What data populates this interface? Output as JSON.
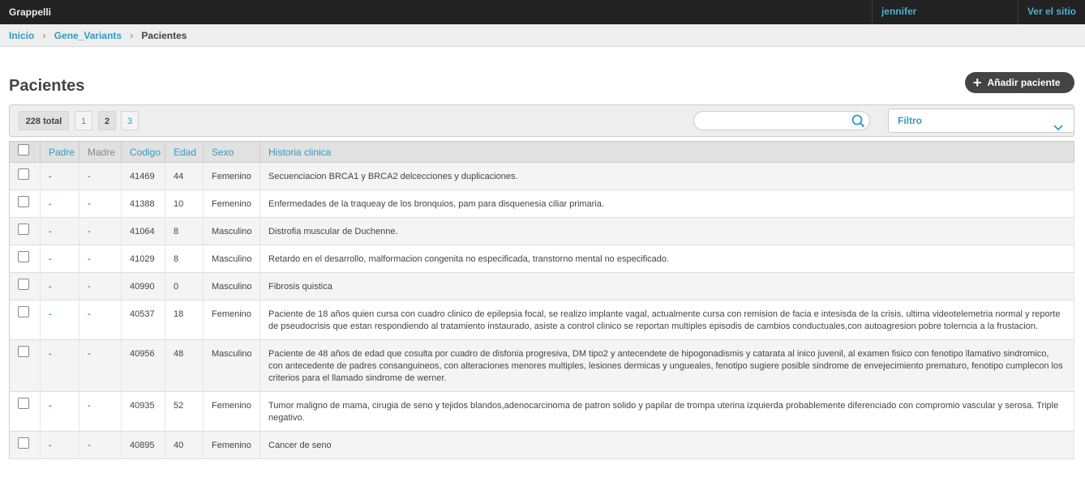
{
  "app": {
    "brand": "Grappelli",
    "user": "jennifer",
    "view_site": "Ver el sitio"
  },
  "breadcrumb": [
    "Inicio",
    "Gene_Variants",
    "Pacientes"
  ],
  "page": {
    "title": "Pacientes",
    "add_button": "Añadir paciente"
  },
  "toolbar": {
    "total": "228 total",
    "pages": [
      "1",
      "2",
      "3"
    ],
    "active_page": "2",
    "search_placeholder": "",
    "filter_label": "Filtro"
  },
  "table": {
    "columns": [
      "Padre",
      "Madre",
      "Codigo",
      "Edad",
      "Sexo",
      "Historia clinica"
    ],
    "rows": [
      {
        "padre": "-",
        "madre": "-",
        "codigo": "41469",
        "edad": "44",
        "sexo": "Femenino",
        "historia": "Secuenciacion BRCA1 y BRCA2 delcecciones y duplicaciones."
      },
      {
        "padre": "-",
        "madre": "-",
        "codigo": "41388",
        "edad": "10",
        "sexo": "Femenino",
        "historia": "Enfermedades de la traqueay de los bronquios, pam para disquenesia ciliar primaria."
      },
      {
        "padre": "-",
        "madre": "-",
        "codigo": "41064",
        "edad": "8",
        "sexo": "Masculino",
        "historia": "Distrofia muscular de Duchenne."
      },
      {
        "padre": "-",
        "madre": "-",
        "codigo": "41029",
        "edad": "8",
        "sexo": "Masculino",
        "historia": "Retardo en el desarrollo, malformacion congenita no especificada, transtorno mental no especificado."
      },
      {
        "padre": "-",
        "madre": "-",
        "codigo": "40990",
        "edad": "0",
        "sexo": "Masculino",
        "historia": "Fibrosis quistica"
      },
      {
        "padre": "-",
        "madre": "-",
        "codigo": "40537",
        "edad": "18",
        "sexo": "Femenino",
        "historia": "Paciente de 18 años quien cursa con cuadro clinico de epilepsia focal, se realizo implante vagal, actualmente cursa con remision de facia e intesisda de la crisis, ultima videotelemetria normal y reporte de pseudocrisis que estan respondiendo al tratamiento instaurado, asiste a control clinico se reportan multiples episodis de cambios conductuales,con autoagresion pobre tolerncia a la frustacion."
      },
      {
        "padre": "-",
        "madre": "-",
        "codigo": "40956",
        "edad": "48",
        "sexo": "Masculino",
        "historia": "Paciente de 48 años de edad que cosulta por cuadro de disfonia progresiva, DM tipo2 y antecendete de hipogonadismis y catarata al inico juvenil, al examen fisico con fenotipo llamativo sindromico, con antecedente de padres consanguineos, con alteraciones menores multiples, lesiones dermicas y ungueales, fenotipo sugiere posible sindrome de envejecimiento prematuro, fenotipo cumplecon los criterios para el llamado sindrome de werner."
      },
      {
        "padre": "-",
        "madre": "-",
        "codigo": "40935",
        "edad": "52",
        "sexo": "Femenino",
        "historia": "Tumor maligno de mama, cirugia de seno y tejidos blandos,adenocarcinoma de patron solido y papilar de trompa uterina izquierda probablemente diferenciado con compromio vascular y serosa. Triple negativo."
      },
      {
        "padre": "-",
        "madre": "-",
        "codigo": "40895",
        "edad": "40",
        "sexo": "Femenino",
        "historia": "Cancer de seno"
      }
    ]
  }
}
